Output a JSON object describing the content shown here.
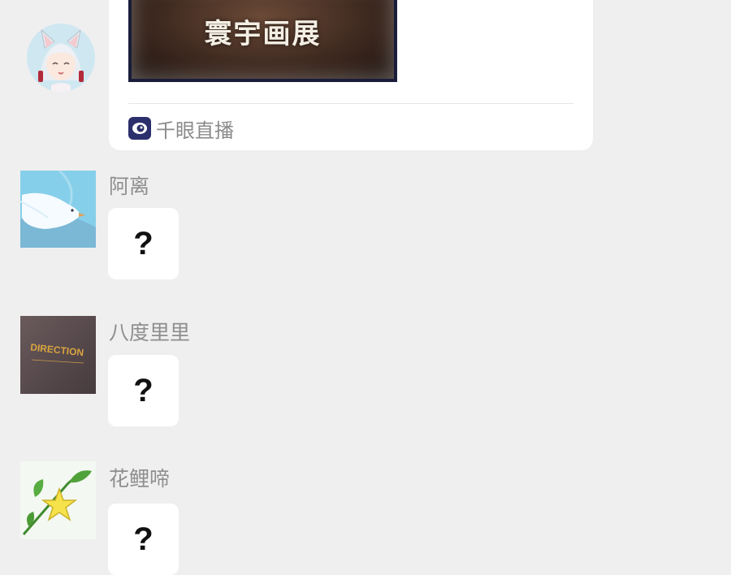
{
  "share_card": {
    "cover_title": "寰宇画展",
    "source_label": "千眼直播"
  },
  "messages": [
    {
      "username": "阿离",
      "text": "?",
      "avatar_icon": "bird-icon"
    },
    {
      "username": "八度里里",
      "text": "?",
      "avatar_icon": "direction-book-icon",
      "avatar_text": "DIRECTION"
    },
    {
      "username": "花鲤啼",
      "text": "?",
      "avatar_icon": "star-leaf-icon"
    }
  ],
  "colors": {
    "background": "#efefef",
    "bubble": "#ffffff",
    "username": "#8e8e8e",
    "source_icon": "#2b2f6b"
  }
}
